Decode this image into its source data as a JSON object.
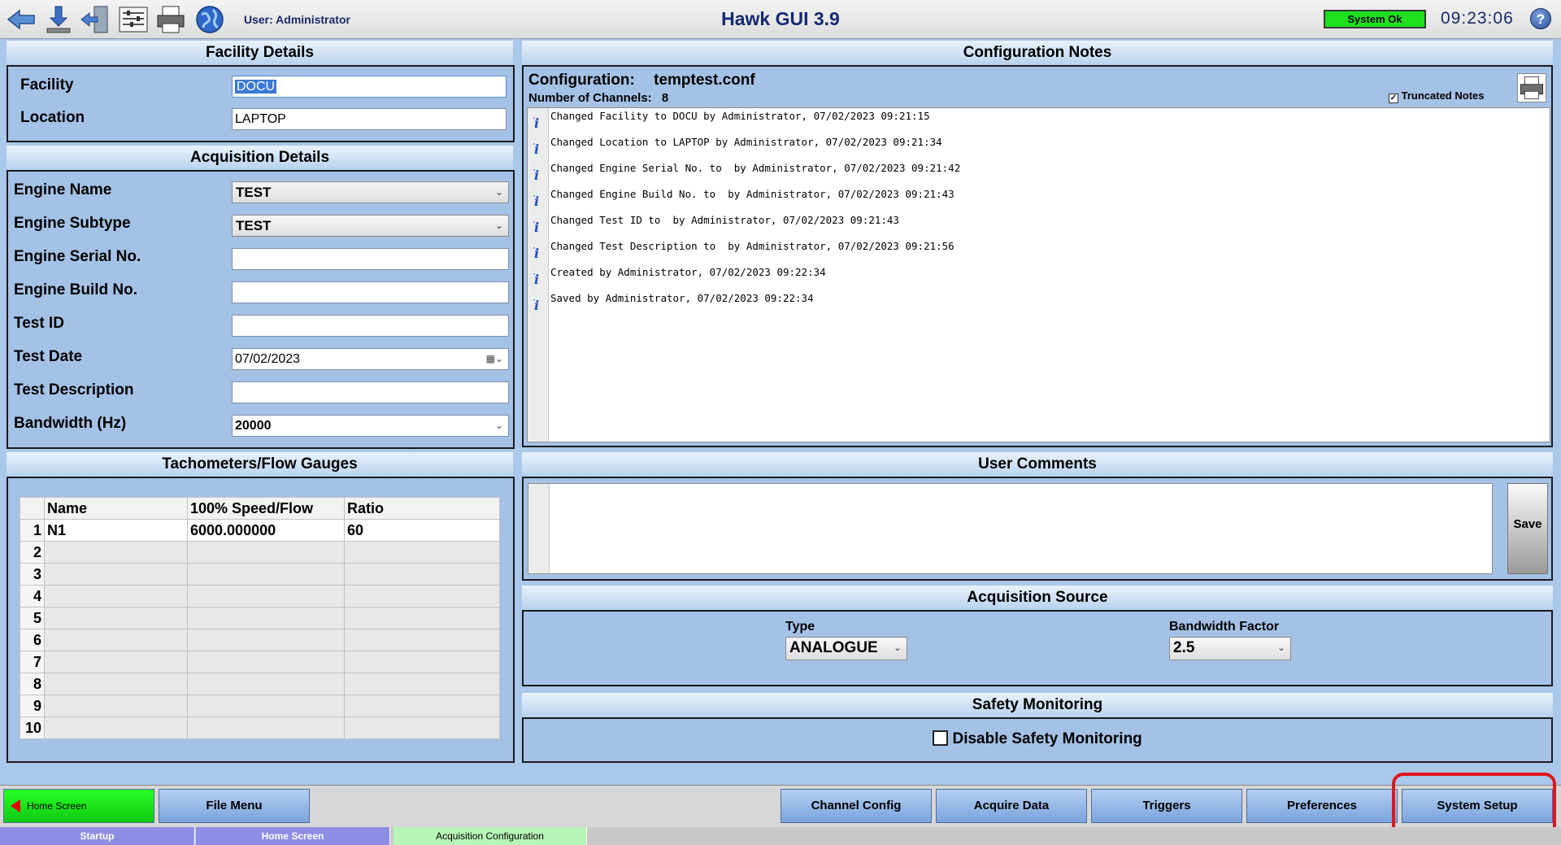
{
  "header": {
    "user_label": "User: Administrator",
    "title": "Hawk GUI 3.9",
    "status": "System Ok",
    "clock": "09:23:06",
    "help": "?",
    "icons": [
      "back-arrow-icon",
      "download-icon",
      "exit-door-icon",
      "config-panel-icon",
      "printer-icon",
      "globe-icon"
    ]
  },
  "facility": {
    "heading": "Facility Details",
    "facility_label": "Facility",
    "facility_value": "DOCU",
    "location_label": "Location",
    "location_value": "LAPTOP"
  },
  "acquisition": {
    "heading": "Acquisition Details",
    "engine_name_label": "Engine Name",
    "engine_name_value": "TEST",
    "engine_subtype_label": "Engine Subtype",
    "engine_subtype_value": "TEST",
    "serial_label": "Engine Serial No.",
    "serial_value": "",
    "build_label": "Engine Build No.",
    "build_value": "",
    "test_id_label": "Test ID",
    "test_id_value": "",
    "test_date_label": "Test Date",
    "test_date_value": "07/02/2023",
    "test_desc_label": "Test Description",
    "test_desc_value": "",
    "bandwidth_label": "Bandwidth (Hz)",
    "bandwidth_value": "20000"
  },
  "tacho": {
    "heading": "Tachometers/Flow Gauges",
    "columns": [
      "Name",
      "100% Speed/Flow",
      "Ratio"
    ],
    "rows": [
      {
        "num": "1",
        "name": "N1",
        "speed": "6000.000000",
        "ratio": "60"
      },
      {
        "num": "2",
        "name": "",
        "speed": "",
        "ratio": ""
      },
      {
        "num": "3",
        "name": "",
        "speed": "",
        "ratio": ""
      },
      {
        "num": "4",
        "name": "",
        "speed": "",
        "ratio": ""
      },
      {
        "num": "5",
        "name": "",
        "speed": "",
        "ratio": ""
      },
      {
        "num": "6",
        "name": "",
        "speed": "",
        "ratio": ""
      },
      {
        "num": "7",
        "name": "",
        "speed": "",
        "ratio": ""
      },
      {
        "num": "8",
        "name": "",
        "speed": "",
        "ratio": ""
      },
      {
        "num": "9",
        "name": "",
        "speed": "",
        "ratio": ""
      },
      {
        "num": "10",
        "name": "",
        "speed": "",
        "ratio": ""
      }
    ]
  },
  "config_notes": {
    "heading": "Configuration Notes",
    "config_label": "Configuration:",
    "config_value": "temptest.conf",
    "channels_label": "Number of Channels:",
    "channels_value": "8",
    "truncated_label": "Truncated Notes",
    "truncated_checked": true,
    "notes": [
      "Changed Facility to DOCU by Administrator, 07/02/2023 09:21:15",
      "Changed Location to LAPTOP by Administrator, 07/02/2023 09:21:34",
      "Changed Engine Serial No. to  by Administrator, 07/02/2023 09:21:42",
      "Changed Engine Build No. to  by Administrator, 07/02/2023 09:21:43",
      "Changed Test ID to  by Administrator, 07/02/2023 09:21:43",
      "Changed Test Description to  by Administrator, 07/02/2023 09:21:56",
      "Created by Administrator, 07/02/2023 09:22:34",
      "Saved by Administrator, 07/02/2023 09:22:34"
    ]
  },
  "user_comments": {
    "heading": "User Comments",
    "save_label": "Save"
  },
  "acq_source": {
    "heading": "Acquisition Source",
    "type_label": "Type",
    "type_value": "ANALOGUE",
    "bw_factor_label": "Bandwidth Factor",
    "bw_factor_value": "2.5"
  },
  "safety": {
    "heading": "Safety Monitoring",
    "disable_label": "Disable Safety Monitoring",
    "disable_checked": false
  },
  "nav": {
    "home": "Home Screen",
    "file_menu": "File Menu",
    "channel_config": "Channel Config",
    "acquire_data": "Acquire Data",
    "triggers": "Triggers",
    "preferences": "Preferences",
    "system_setup": "System Setup"
  },
  "tabs": [
    "Startup",
    "Home Screen",
    "Acquisition Configuration"
  ],
  "colors": {
    "status_ok": "#1ee01e",
    "home_button": "#10c810",
    "highlight_ring": "#e0141a",
    "active_tab": "#b8f5b8",
    "inactive_tab": "#8e8ee6"
  }
}
